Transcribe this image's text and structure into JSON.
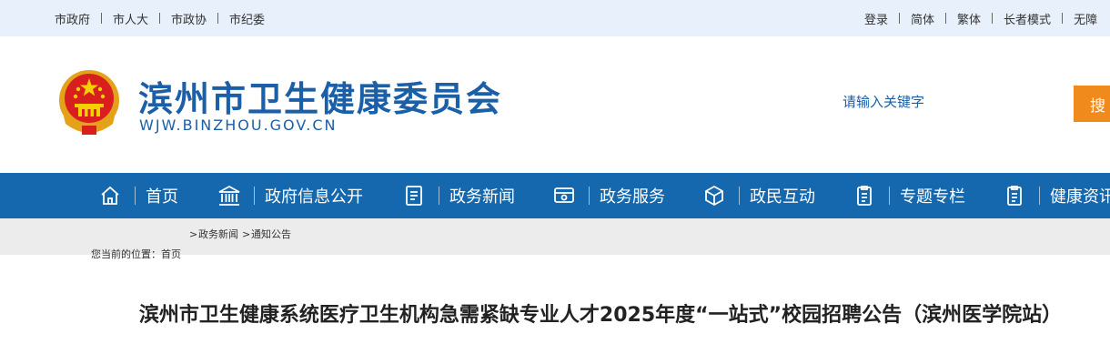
{
  "colors": {
    "accent": "#1568ad",
    "brand_text": "#1a5fa8",
    "search_button": "#f08a1c",
    "top_bar": "#e8f0fb",
    "crumb_band": "#ececec"
  },
  "topbar": {
    "left_links": [
      "市政府",
      "市人大",
      "市政协",
      "市纪委"
    ],
    "right_links": [
      "登录",
      "简体",
      "繁体",
      "长者模式",
      "无障"
    ]
  },
  "header": {
    "emblem_icon": "national-emblem-icon",
    "title": "滨州市卫生健康委员会",
    "domain": "WJW.BINZHOU.GOV.CN",
    "search_placeholder": "请输入关键字",
    "search_button": "搜"
  },
  "nav": {
    "items": [
      {
        "label": "首页",
        "icon": "home-icon"
      },
      {
        "label": "政府信息公开",
        "icon": "government-building-icon"
      },
      {
        "label": "政务新闻",
        "icon": "news-document-icon"
      },
      {
        "label": "政务服务",
        "icon": "service-window-icon"
      },
      {
        "label": "政民互动",
        "icon": "interaction-cube-icon"
      },
      {
        "label": "专题专栏",
        "icon": "topic-document-icon"
      },
      {
        "label": "健康资讯",
        "icon": "health-document-icon"
      }
    ]
  },
  "breadcrumb": {
    "lead": "您当前的位置：首页",
    "sep": ">",
    "items": [
      "政务新闻",
      "通知公告"
    ]
  },
  "article": {
    "title": "滨州市卫生健康系统医疗卫生机构急需紧缺专业人才2025年度“一站式”校园招聘公告（滨州医学院站）"
  }
}
